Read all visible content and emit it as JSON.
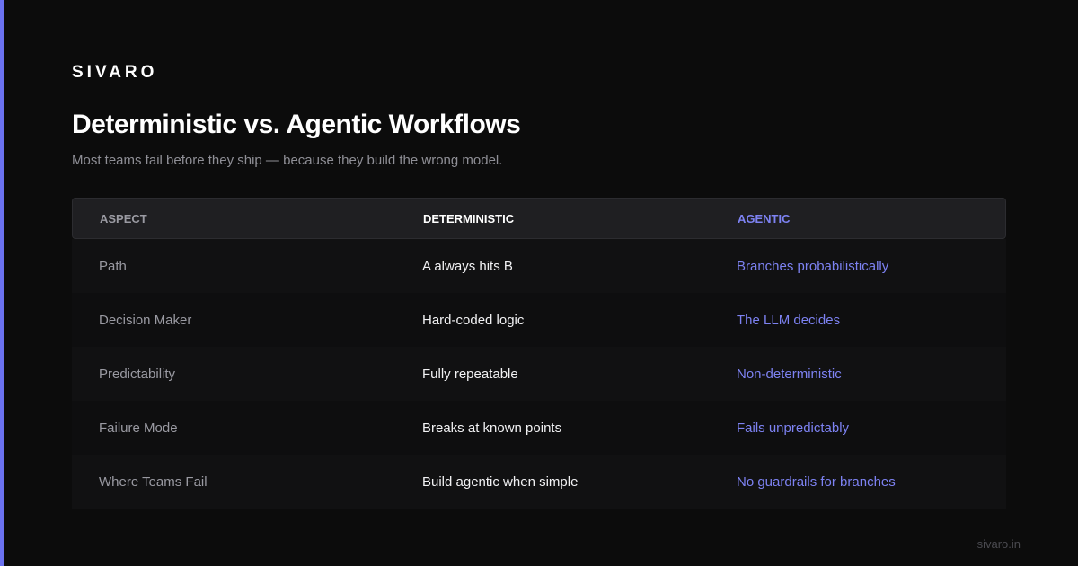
{
  "brand": "SIVARO",
  "title": "Deterministic vs. Agentic Workflows",
  "subtitle": "Most teams fail before they ship — because they build the wrong model.",
  "table": {
    "headers": [
      "ASPECT",
      "DETERMINISTIC",
      "AGENTIC"
    ],
    "rows": [
      [
        "Path",
        "A always hits B",
        "Branches probabilistically"
      ],
      [
        "Decision Maker",
        "Hard-coded logic",
        "The LLM decides"
      ],
      [
        "Predictability",
        "Fully repeatable",
        "Non-deterministic"
      ],
      [
        "Failure Mode",
        "Breaks at known points",
        "Fails unpredictably"
      ],
      [
        "Where Teams Fail",
        "Build agentic when simple",
        "No guardrails for branches"
      ]
    ]
  },
  "footer": "sivaro.in",
  "colors": {
    "accent": "#6b72f0",
    "background": "#0c0c0c",
    "agentic_text": "#7d82f2"
  }
}
